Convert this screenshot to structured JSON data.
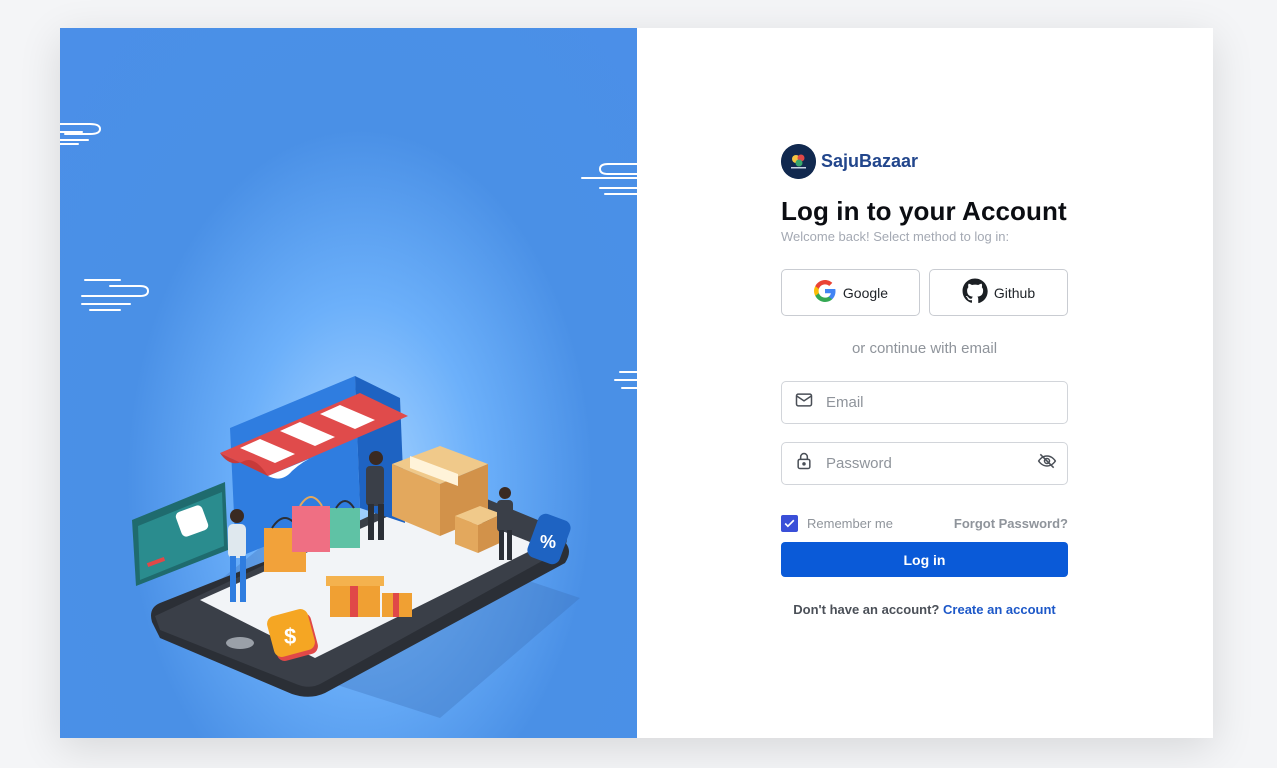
{
  "brand": {
    "name": "SajuBazaar"
  },
  "heading": {
    "title": "Log in to your Account",
    "subtitle": "Welcome back! Select method to log in:"
  },
  "social": {
    "google_label": "Google",
    "github_label": "Github"
  },
  "divider_text": "or continue with email",
  "email": {
    "placeholder": "Email",
    "value": ""
  },
  "password": {
    "placeholder": "Password",
    "value": ""
  },
  "remember": {
    "label": "Remember me",
    "checked": true
  },
  "forgot_label": "Forgot Password?",
  "login_label": "Log in",
  "signup": {
    "prompt": "Don't have an account?",
    "link_label": "Create an account"
  },
  "icons": {
    "brand": "brand-logo-icon",
    "google": "google-icon",
    "github": "github-icon",
    "email": "envelope-icon",
    "password": "lock-icon",
    "toggle": "eye-off-icon",
    "check": "check-icon"
  },
  "colors": {
    "primary": "#0a5ad8",
    "brand_text": "#22468c",
    "hero_bg": "#4b8fe8",
    "checkbox": "#3a4fd8",
    "link": "#1d58c8"
  }
}
